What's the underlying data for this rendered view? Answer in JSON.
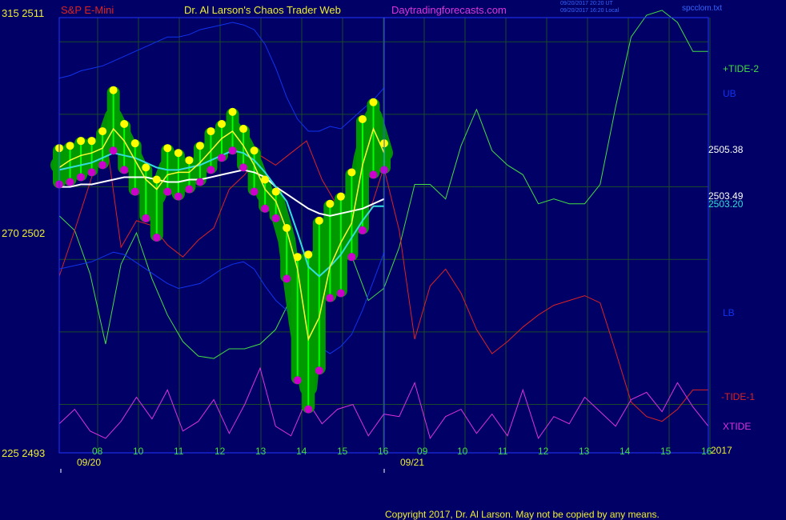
{
  "header": {
    "instrument": "S&P E-Mini",
    "author": "Dr. Al Larson's Chaos Trader Web",
    "site": "Daytradingforecasts.com",
    "timestamp_ut": "09/20/2017 20:20 UT",
    "timestamp_local": "09/20/2017 16:20 Local",
    "file": "spcclom.txt",
    "year": "2017"
  },
  "footer": {
    "copyright": "Copyright 2017, Dr. Al Larson. May not be copied by any means."
  },
  "colors": {
    "background": "#000066",
    "plot_frame": "#2233ff",
    "grid": "#1b4a2a",
    "price_bar": "#00ff00",
    "price_halo": "#009900",
    "highs": "#ffff00",
    "lows": "#cc00cc",
    "ub": "#1133ee",
    "lb": "#1133ee",
    "tide_plus": "#44dd44",
    "tide_minus": "#dd2222",
    "xtide": "#dd33dd",
    "ma_fast": "#ffff33",
    "ma_mid": "#33dddd",
    "ma_slow": "#ffffff"
  },
  "chart_data": {
    "type": "line",
    "title": "S&P E-Mini",
    "y_axis_left": {
      "ticks": [
        {
          "label": "315 2511",
          "value": 2511
        },
        {
          "label": "270 2502",
          "value": 2502
        },
        {
          "label": "225 2493",
          "value": 2493
        }
      ],
      "ylim": [
        2493,
        2511
      ]
    },
    "x_axis": {
      "hour_ticks": [
        "08",
        "10",
        "11",
        "12",
        "13",
        "14",
        "15",
        "16",
        "09",
        "10",
        "11",
        "12",
        "13",
        "14",
        "15",
        "16"
      ],
      "date_labels": [
        "09/20",
        "09/21"
      ],
      "grid": true
    },
    "right_labels": [
      {
        "text": "+TIDE-2",
        "series": "tide_plus"
      },
      {
        "text": "UB",
        "series": "ub"
      },
      {
        "text": "2505.38",
        "series": "price"
      },
      {
        "text": "2503.49",
        "series": "ma_slow"
      },
      {
        "text": "2503.20",
        "series": "ma_mid"
      },
      {
        "text": "LB",
        "series": "lb"
      },
      {
        "text": "-TIDE-1",
        "series": "tide_minus"
      },
      {
        "text": "XTIDE",
        "series": "xtide"
      }
    ],
    "series": [
      {
        "name": "UB",
        "values": [
          2508.5,
          2508.6,
          2508.8,
          2508.9,
          2509.0,
          2509.2,
          2509.4,
          2509.6,
          2509.8,
          2510.0,
          2510.2,
          2510.2,
          2510.3,
          2510.5,
          2510.6,
          2510.7,
          2510.8,
          2510.7,
          2510.5,
          2509.9,
          2508.9,
          2507.7,
          2506.8,
          2506.3,
          2506.3,
          2506.5,
          2506.4,
          2506.8,
          2507.2,
          2507.6,
          2508.1
        ]
      },
      {
        "name": "LB",
        "values": [
          2500.6,
          2500.7,
          2500.8,
          2500.9,
          2501.1,
          2501.3,
          2501.2,
          2500.9,
          2500.6,
          2500.3,
          2500.0,
          2499.8,
          2499.9,
          2500.0,
          2500.3,
          2500.6,
          2500.8,
          2500.9,
          2500.6,
          2499.9,
          2499.3,
          2498.9,
          2498.4,
          2497.8,
          2497.4,
          2497.1,
          2497.4,
          2497.9,
          2498.9,
          2500.1,
          2501.3
        ]
      },
      {
        "name": "S&P E-Mini",
        "values": [
          2504.9,
          2505.0,
          2505.2,
          2505.3,
          2505.6,
          2506.9,
          2506.0,
          2505.1,
          2504.1,
          2503.6,
          2504.8,
          2504.7,
          2504.5,
          2504.9,
          2505.4,
          2505.9,
          2506.4,
          2505.8,
          2504.9,
          2503.7,
          2503.4,
          2501.8,
          2498.4,
          2495.7,
          2500.6,
          2502.1,
          2501.7,
          2502.6,
          2505.2,
          2506.9,
          2505.4
        ]
      },
      {
        "name": "price_high",
        "values": [
          2505.5,
          2505.6,
          2505.8,
          2505.8,
          2506.2,
          2507.9,
          2506.5,
          2505.7,
          2504.7,
          2504.2,
          2505.5,
          2505.3,
          2505.0,
          2505.6,
          2506.2,
          2506.5,
          2507.0,
          2506.3,
          2505.4,
          2504.2,
          2503.7,
          2502.2,
          2501.0,
          2501.1,
          2502.5,
          2503.2,
          2503.5,
          2504.5,
          2506.7,
          2507.4,
          2505.7
        ]
      },
      {
        "name": "price_low",
        "values": [
          2504.2,
          2504.3,
          2504.5,
          2504.7,
          2505.0,
          2505.6,
          2504.8,
          2503.9,
          2502.8,
          2502.0,
          2503.9,
          2503.7,
          2504.0,
          2504.3,
          2504.8,
          2505.3,
          2505.6,
          2504.9,
          2503.9,
          2503.2,
          2502.8,
          2500.3,
          2496.1,
          2494.9,
          2496.5,
          2499.5,
          2499.7,
          2501.2,
          2502.3,
          2504.6,
          2504.8
        ]
      },
      {
        "name": "MA fast",
        "values": [
          2504.8,
          2505.1,
          2505.3,
          2505.4,
          2505.6,
          2506.4,
          2505.9,
          2505.1,
          2504.3,
          2503.9,
          2504.5,
          2504.6,
          2504.6,
          2505.0,
          2505.5,
          2506.0,
          2506.3,
          2505.7,
          2504.9,
          2503.9,
          2503.4,
          2502.2,
          2500.6,
          2497.7,
          2498.6,
          2500.7,
          2501.7,
          2502.5,
          2504.9,
          2506.4,
          2505.4
        ]
      },
      {
        "name": "MA mid",
        "values": [
          2504.7,
          2504.8,
          2504.9,
          2505.0,
          2505.2,
          2505.4,
          2505.3,
          2505.2,
          2505.0,
          2504.8,
          2504.7,
          2504.7,
          2504.8,
          2504.9,
          2505.1,
          2505.3,
          2505.5,
          2505.4,
          2505.1,
          2504.6,
          2504.0,
          2503.4,
          2502.1,
          2500.7,
          2500.3,
          2500.7,
          2501.2,
          2501.9,
          2502.6,
          2503.2,
          2503.2
        ]
      },
      {
        "name": "MA slow",
        "values": [
          2504.0,
          2504.0,
          2504.1,
          2504.1,
          2504.2,
          2504.3,
          2504.4,
          2504.4,
          2504.4,
          2504.3,
          2504.2,
          2504.2,
          2504.3,
          2504.3,
          2504.4,
          2504.5,
          2504.6,
          2504.7,
          2504.6,
          2504.4,
          2504.0,
          2503.7,
          2503.4,
          2503.1,
          2502.9,
          2502.8,
          2502.9,
          2503.0,
          2503.1,
          2503.3,
          2503.5
        ]
      }
    ],
    "tide_series": [
      {
        "name": "+TIDE-2",
        "values": [
          2502.8,
          2502.2,
          2500.4,
          2497.5,
          2500.8,
          2502.1,
          2500.2,
          2498.7,
          2497.6,
          2497.0,
          2496.9,
          2497.3,
          2497.3,
          2497.5,
          2498.1,
          2499.4,
          2500.8,
          2502.1,
          2502.4,
          2501.0,
          2499.3,
          2499.8,
          2501.5,
          2504.1,
          2504.1,
          2503.5,
          2505.7,
          2507.2,
          2505.5,
          2504.9,
          2504.5,
          2503.3,
          2503.5,
          2503.3,
          2503.3,
          2504.1,
          2507.3,
          2510.2,
          2511.1,
          2511.3,
          2510.8,
          2509.6,
          2509.6
        ]
      },
      {
        "name": "-TIDE-1",
        "values": [
          2500.3,
          2502.2,
          2504.2,
          2506.2,
          2501.5,
          2502.6,
          2502.4,
          2501.6,
          2501.1,
          2501.8,
          2502.3,
          2503.9,
          2504.5,
          2505.3,
          2504.9,
          2505.4,
          2505.9,
          2504.3,
          2503.2,
          2502.4,
          2502.8,
          2504.8,
          2502.2,
          2497.7,
          2499.9,
          2500.6,
          2499.6,
          2498.1,
          2497.1,
          2497.6,
          2498.2,
          2498.7,
          2499.1,
          2499.3,
          2499.5,
          2499.2,
          2497.2,
          2495.1,
          2494.5,
          2494.3,
          2494.8,
          2495.6,
          2495.6
        ]
      },
      {
        "name": "XTIDE",
        "values": [
          2494.2,
          2494.8,
          2493.9,
          2493.6,
          2494.3,
          2495.3,
          2494.4,
          2495.6,
          2493.9,
          2494.3,
          2495.2,
          2493.8,
          2495.0,
          2496.5,
          2494.1,
          2493.7,
          2495.2,
          2494.2,
          2494.8,
          2495.0,
          2493.7,
          2494.6,
          2494.5,
          2495.9,
          2493.6,
          2494.5,
          2494.8,
          2493.8,
          2494.6,
          2493.7,
          2495.6,
          2493.6,
          2494.5,
          2494.2,
          2495.3,
          2494.7,
          2494.1,
          2495.2,
          2495.5,
          2494.7,
          2495.9,
          2494.9,
          2494.1
        ]
      }
    ]
  }
}
